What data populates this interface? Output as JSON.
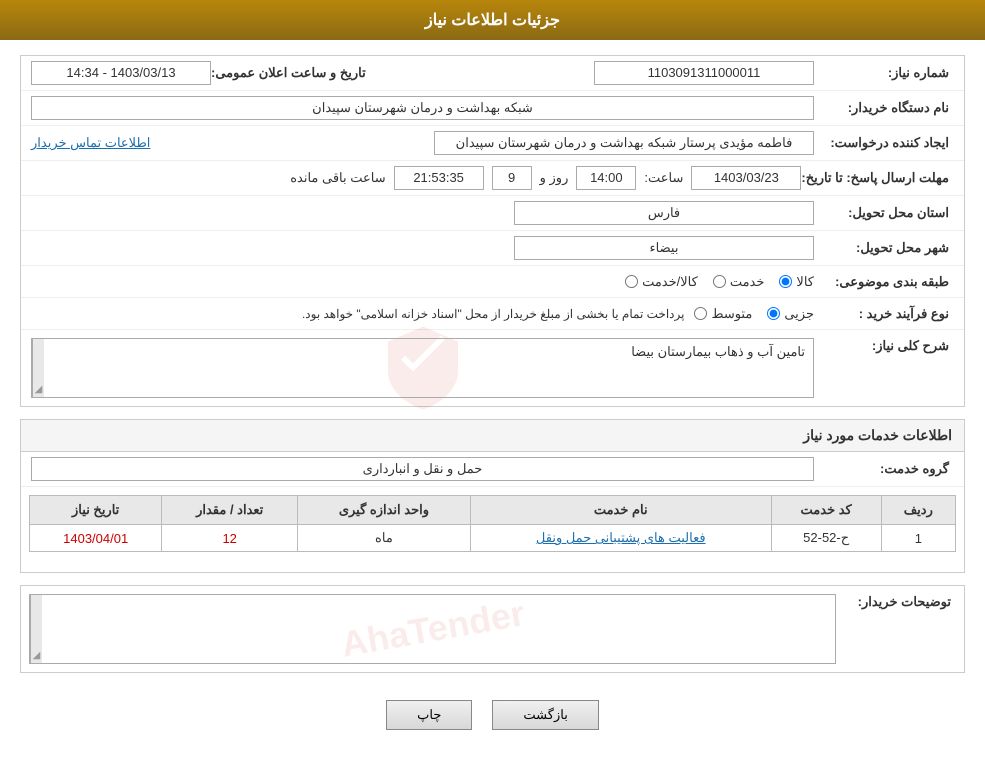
{
  "header": {
    "title": "جزئیات اطلاعات نیاز"
  },
  "form": {
    "need_number_label": "شماره نیاز:",
    "need_number_value": "1103091311000011",
    "buyer_name_label": "نام دستگاه خریدار:",
    "buyer_name_value": "شبکه بهداشت و درمان شهرستان سپیدان",
    "creator_label": "ایجاد کننده درخواست:",
    "creator_value": "فاطمه مؤیدی پرستار  شبکه بهداشت و درمان شهرستان سپیدان",
    "contact_link": "اطلاعات تماس خریدار",
    "deadline_label": "مهلت ارسال پاسخ: تا تاریخ:",
    "deadline_date": "1403/03/23",
    "deadline_time_label": "ساعت:",
    "deadline_time": "14:00",
    "deadline_days_label": "روز و",
    "deadline_days": "9",
    "deadline_remaining_label": "ساعت باقی مانده",
    "deadline_remaining": "21:53:35",
    "announcement_label": "تاریخ و ساعت اعلان عمومی:",
    "announcement_value": "1403/03/13 - 14:34",
    "province_label": "استان محل تحویل:",
    "province_value": "فارس",
    "city_label": "شهر محل تحویل:",
    "city_value": "بیضاء",
    "category_label": "طبقه بندی موضوعی:",
    "category_kala": "کالا",
    "category_khedmat": "خدمت",
    "category_kala_khedmat": "کالا/خدمت",
    "process_label": "نوع فرآیند خرید :",
    "process_jozii": "جزیی",
    "process_motavasset": "متوسط",
    "process_note": "پرداخت تمام یا بخشی از مبلغ خریدار از محل \"اسناد خزانه اسلامی\" خواهد بود.",
    "description_label": "شرح کلی نیاز:",
    "description_value": "تامین آب و ذهاب بیمارستان بیضا"
  },
  "services_section": {
    "title": "اطلاعات خدمات مورد نیاز",
    "service_group_label": "گروه خدمت:",
    "service_group_value": "حمل و نقل و انبارداری"
  },
  "table": {
    "headers": [
      "ردیف",
      "کد خدمت",
      "نام خدمت",
      "واحد اندازه گیری",
      "تعداد / مقدار",
      "تاریخ نیاز"
    ],
    "rows": [
      {
        "row": "1",
        "code": "ح-52-52",
        "name": "فعالیت های پشتیبانی حمل ونقل",
        "unit": "ماه",
        "quantity": "12",
        "date": "1403/04/01"
      }
    ]
  },
  "buyer_description": {
    "label": "توضیحات خریدار:",
    "placeholder": ""
  },
  "buttons": {
    "print": "چاپ",
    "back": "بازگشت"
  }
}
